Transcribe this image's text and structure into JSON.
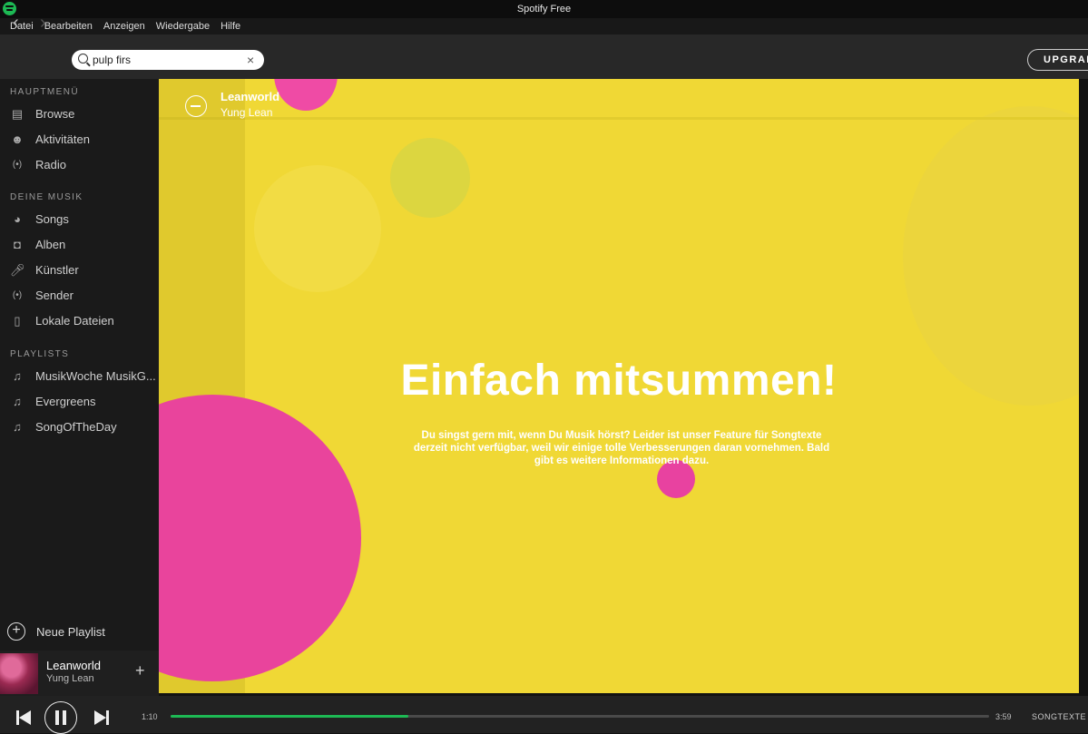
{
  "window": {
    "title": "Spotify Free"
  },
  "menubar": {
    "items": [
      "Datei",
      "Bearbeiten",
      "Anzeigen",
      "Wiedergabe",
      "Hilfe"
    ]
  },
  "topbar": {
    "search_value": "pulp firs",
    "clear_icon": "×",
    "upgrade_label": "UPGRADE"
  },
  "sidebar": {
    "main_title": "HAUPTMENÜ",
    "main_items": [
      {
        "label": "Browse",
        "icon": "browse-icon"
      },
      {
        "label": "Aktivitäten",
        "icon": "activity-icon"
      },
      {
        "label": "Radio",
        "icon": "radio-icon"
      }
    ],
    "music_title": "DEINE MUSIK",
    "music_items": [
      {
        "label": "Songs",
        "icon": "songs-icon"
      },
      {
        "label": "Alben",
        "icon": "album-icon"
      },
      {
        "label": "Künstler",
        "icon": "artist-icon"
      },
      {
        "label": "Sender",
        "icon": "station-icon"
      },
      {
        "label": "Lokale Dateien",
        "icon": "local-files-icon"
      }
    ],
    "playlists_title": "PLAYLISTS",
    "playlists": [
      {
        "label": "MusikWoche MusikG...",
        "icon": "playlist-icon"
      },
      {
        "label": "Evergreens",
        "icon": "playlist-icon"
      },
      {
        "label": "SongOfTheDay",
        "icon": "playlist-icon"
      }
    ],
    "new_playlist_label": "Neue Playlist"
  },
  "now_playing": {
    "title": "Leanworld",
    "artist": "Yung Lean"
  },
  "player": {
    "elapsed": "1:10",
    "total": "3:59",
    "progress_fraction": 0.29,
    "lyrics_label": "SONGTEXTE",
    "accent_color": "#1db954"
  },
  "lyrics_overlay": {
    "track_title": "Leanworld",
    "track_artist": "Yung Lean",
    "headline": "Einfach mitsummen!",
    "message": "Du singst gern mit, wenn Du Musik hörst? Leider ist unser Feature für Songtexte derzeit nicht verfügbar, weil wir einige tolle Verbesserungen daran vornehmen. Bald gibt es weitere Informationen dazu.",
    "background_color": "#f0d835",
    "circle_color": "#e9449c"
  }
}
